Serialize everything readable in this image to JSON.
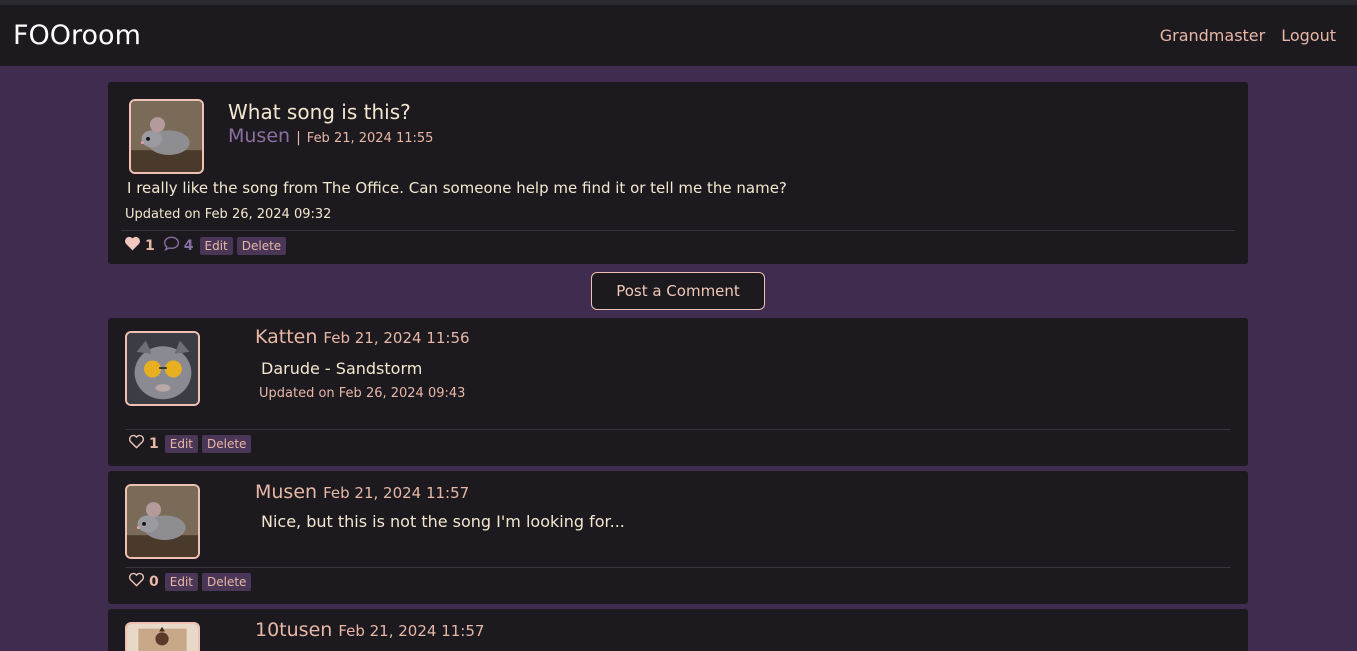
{
  "nav": {
    "brand": "FOOroom",
    "links": [
      "Grandmaster",
      "Logout"
    ]
  },
  "post": {
    "title": "What song is this?",
    "author": "Musen",
    "separator": "|",
    "date": "Feb 21, 2024 11:55",
    "body": "I really like the song from The Office. Can someone help me find it or tell me the name?",
    "updated": "Updated on Feb 26, 2024 09:32",
    "likes": "1",
    "comments": "4",
    "edit_label": "Edit",
    "delete_label": "Delete"
  },
  "post_comment_label": "Post a Comment",
  "comments": [
    {
      "author": "Katten",
      "date": "Feb 21, 2024 11:56",
      "body": "Darude - Sandstorm",
      "updated": "Updated on Feb 26, 2024 09:43",
      "likes": "1",
      "avatar": "cat-with-sunglasses",
      "edit_label": "Edit",
      "delete_label": "Delete"
    },
    {
      "author": "Musen",
      "date": "Feb 21, 2024 11:57",
      "body": "Nice, but this is not the song I'm looking for...",
      "likes": "0",
      "avatar": "mouse",
      "edit_label": "Edit",
      "delete_label": "Delete"
    },
    {
      "author": "10tusen",
      "date": "Feb 21, 2024 11:57",
      "avatar": "card-skull"
    }
  ],
  "colors": {
    "background": "#3f2c4f",
    "card": "#1c1a1f",
    "accent": "#e8b7a6",
    "muted_purple": "#8a6fa0",
    "text": "#f3e8cf"
  }
}
